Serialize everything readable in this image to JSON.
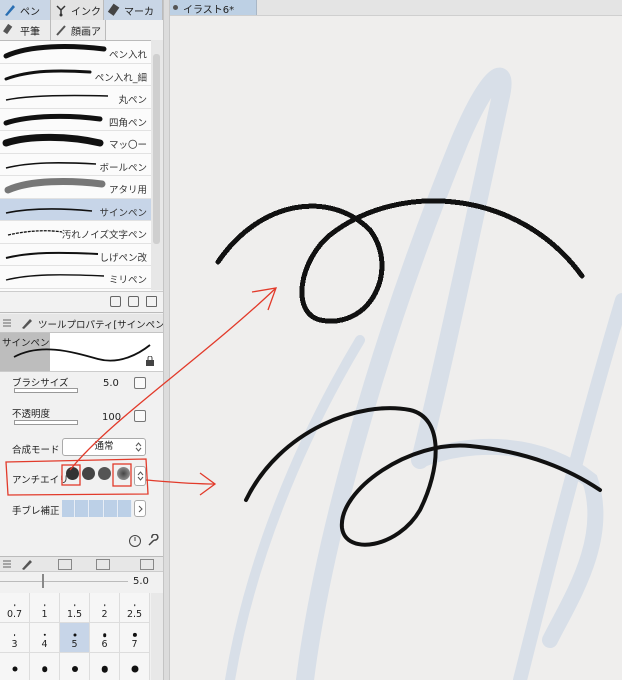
{
  "tool_tabs_row1": [
    {
      "label": "ペン",
      "icon": "pen-icon",
      "active": true
    },
    {
      "label": "インク",
      "icon": "ink-icon",
      "active": false
    },
    {
      "label": "マーカ",
      "icon": "marker-icon",
      "active": true
    }
  ],
  "tool_tabs_row2": [
    {
      "label": "平筆",
      "icon": "flat-brush-icon"
    },
    {
      "label": "顔画ア",
      "icon": "face-brush-icon"
    }
  ],
  "brushes": [
    {
      "name": "ペン入れ"
    },
    {
      "name": "ペン入れ_細"
    },
    {
      "name": "丸ペン"
    },
    {
      "name": "四角ペン"
    },
    {
      "name": "マッ〇ー"
    },
    {
      "name": "ボールペン"
    },
    {
      "name": "アタリ用"
    },
    {
      "name": "サインペン",
      "selected": true
    },
    {
      "name": "汚れノイズ文字ペン"
    },
    {
      "name": "しげペン改"
    },
    {
      "name": "ミリペン"
    }
  ],
  "tool_property": {
    "title": "ツールプロパティ[サインペン",
    "preview_label": "サインペン",
    "brush_size_label": "ブラシサイズ",
    "brush_size_value": "5.0",
    "opacity_label": "不透明度",
    "opacity_value": "100",
    "blend_mode_label": "合成モード",
    "blend_mode_value": "通常",
    "antialias_label": "アンチエイリ",
    "antialias_level": 3,
    "stabilization_label": "手ブレ補正"
  },
  "brush_size_palette": {
    "current_value": "5.0",
    "cells": [
      {
        "label": "0.7",
        "dot": 0.4
      },
      {
        "label": "1",
        "dot": 0.6
      },
      {
        "label": "1.5",
        "dot": 0.9
      },
      {
        "label": "2",
        "dot": 1.2
      },
      {
        "label": "2.5",
        "dot": 1.5
      },
      {
        "label": "3",
        "dot": 1.8
      },
      {
        "label": "4",
        "dot": 2.4
      },
      {
        "label": "5",
        "dot": 3.0,
        "selected": true
      },
      {
        "label": "6",
        "dot": 3.6
      },
      {
        "label": "7",
        "dot": 4.2
      },
      {
        "label": "",
        "dot": 5.0
      },
      {
        "label": "",
        "dot": 5.5
      },
      {
        "label": "",
        "dot": 6.0
      },
      {
        "label": "",
        "dot": 6.5
      },
      {
        "label": "",
        "dot": 7.0
      }
    ]
  },
  "document": {
    "tab_title": "イラスト6*"
  },
  "colors": {
    "annotation_red": "#e23a2a",
    "selection_blue": "#c7d5e8",
    "stroke_black": "#111111",
    "sketch_blue": "#d6dee8"
  }
}
